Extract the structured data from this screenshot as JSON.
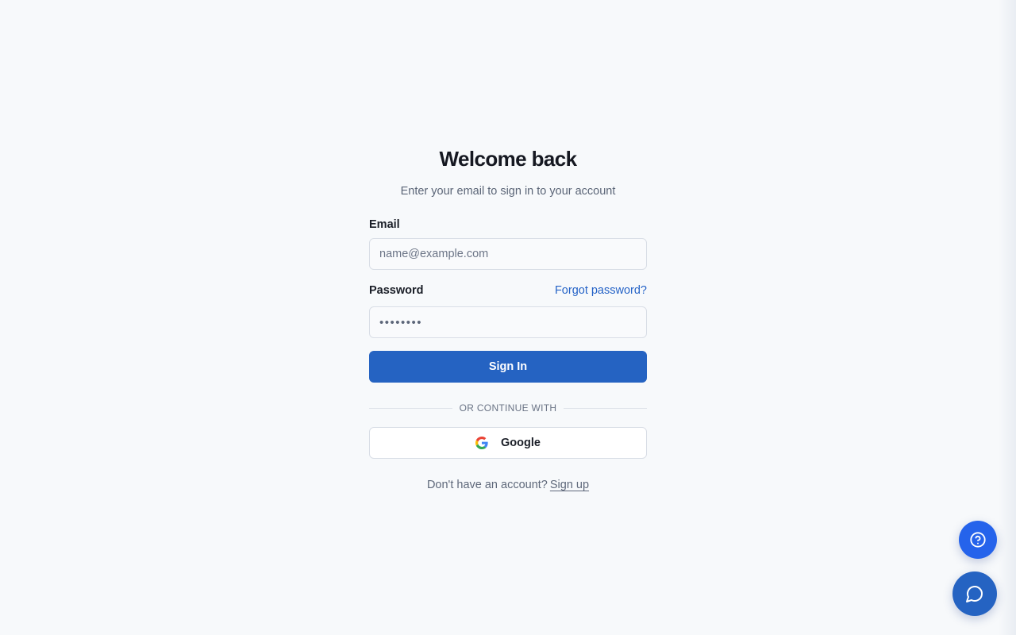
{
  "header": {
    "title": "Welcome back",
    "subtitle": "Enter your email to sign in to your account"
  },
  "form": {
    "email_label": "Email",
    "email_placeholder": "name@example.com",
    "email_value": "",
    "password_label": "Password",
    "forgot_password": "Forgot password?",
    "password_value": "••••••••",
    "signin_label": "Sign In"
  },
  "divider": {
    "text": "OR CONTINUE WITH"
  },
  "social": {
    "google_label": "Google",
    "google_icon": "google-icon"
  },
  "footer": {
    "prompt": "Don't have an account?",
    "signup_link": "Sign up"
  },
  "floating": {
    "help_icon": "help-icon",
    "chat_icon": "chat-icon"
  },
  "colors": {
    "background": "#f7f9fb",
    "primary": "#2563c2",
    "link": "#2563c7",
    "help_fab": "#2563eb"
  }
}
